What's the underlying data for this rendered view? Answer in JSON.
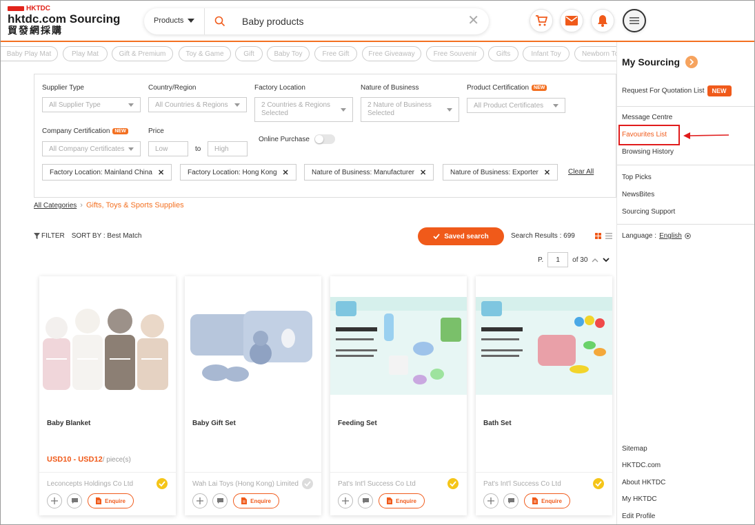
{
  "header": {
    "logo_small": "HKTDC",
    "logo_main": "hktdc.com Sourcing",
    "logo_cn": "貿發網採購",
    "products_dropdown": "Products",
    "search_value": "Baby products"
  },
  "tags": [
    "Baby Play Mat",
    "Play Mat",
    "Gift & Premium",
    "Toy & Game",
    "Gift",
    "Baby Toy",
    "Free Gift",
    "Free Giveaway",
    "Free Souvenir",
    "Gifts",
    "Infant Toy",
    "Newborn To"
  ],
  "filters": {
    "supplier_type": {
      "label": "Supplier Type",
      "value": "All Supplier Type"
    },
    "country": {
      "label": "Country/Region",
      "value": "All Countries & Regions"
    },
    "factory": {
      "label": "Factory Location",
      "value_line1": "2 Countries & Regions",
      "value_line2": "Selected"
    },
    "nature": {
      "label": "Nature of Business",
      "value_line1": "2 Nature of Business",
      "value_line2": "Selected"
    },
    "product_cert": {
      "label": "Product Certification",
      "badge": "NEW",
      "value": "All Product Certificates"
    },
    "company_cert": {
      "label": "Company Certification",
      "badge": "NEW",
      "value": "All Company Certificates"
    },
    "price": {
      "label": "Price",
      "low": "Low",
      "to": "to",
      "high": "High"
    },
    "online_purchase": "Online Purchase",
    "chips": [
      "Factory Location: Mainland China",
      "Factory Location: Hong Kong",
      "Nature of Business: Manufacturer",
      "Nature of Business: Exporter"
    ],
    "clear_all": "Clear All"
  },
  "breadcrumb": {
    "all": "All Categories",
    "category": "Gifts, Toys & Sports Supplies"
  },
  "toolbar": {
    "filter": "FILTER",
    "sort_by": "SORT BY : Best Match",
    "saved_search": "Saved search",
    "results": "Search Results : 699",
    "page_label": "P.",
    "page": "1",
    "of_pages": "of 30"
  },
  "products": [
    {
      "name": "Baby Blanket",
      "price": "USD10 - USD12",
      "unit": "/ piece(s)",
      "company": "Leconcepts Holdings Co Ltd",
      "enquire": "Enquire"
    },
    {
      "name": "Baby Gift Set",
      "price": "",
      "unit": "",
      "company": "Wah Lai Toys (Hong Kong) Limited",
      "enquire": "Enquire"
    },
    {
      "name": "Feeding Set",
      "price": "",
      "unit": "",
      "company": "Pat's Int'l Success Co Ltd",
      "enquire": "Enquire"
    },
    {
      "name": "Bath Set",
      "price": "",
      "unit": "",
      "company": "Pat's Int'l Success Co Ltd",
      "enquire": "Enquire"
    }
  ],
  "side_menu": {
    "title": "My Sourcing",
    "rfq": "Request For Quotation List",
    "rfq_badge": "NEW",
    "message_centre": "Message Centre",
    "favourites": "Favourites List",
    "browsing_history": "Browsing History",
    "top_picks": "Top Picks",
    "newsbites": "NewsBites",
    "sourcing_support": "Sourcing Support",
    "language_label": "Language :",
    "language_value": "English",
    "sitemap": "Sitemap",
    "hktdc_com": "HKTDC.com",
    "about": "About HKTDC",
    "my_hktdc": "My HKTDC",
    "edit_profile": "Edit Profile"
  },
  "colors": {
    "accent": "#f05a1a",
    "highlight_border": "#e01b1b",
    "verified": "#f5c518"
  }
}
